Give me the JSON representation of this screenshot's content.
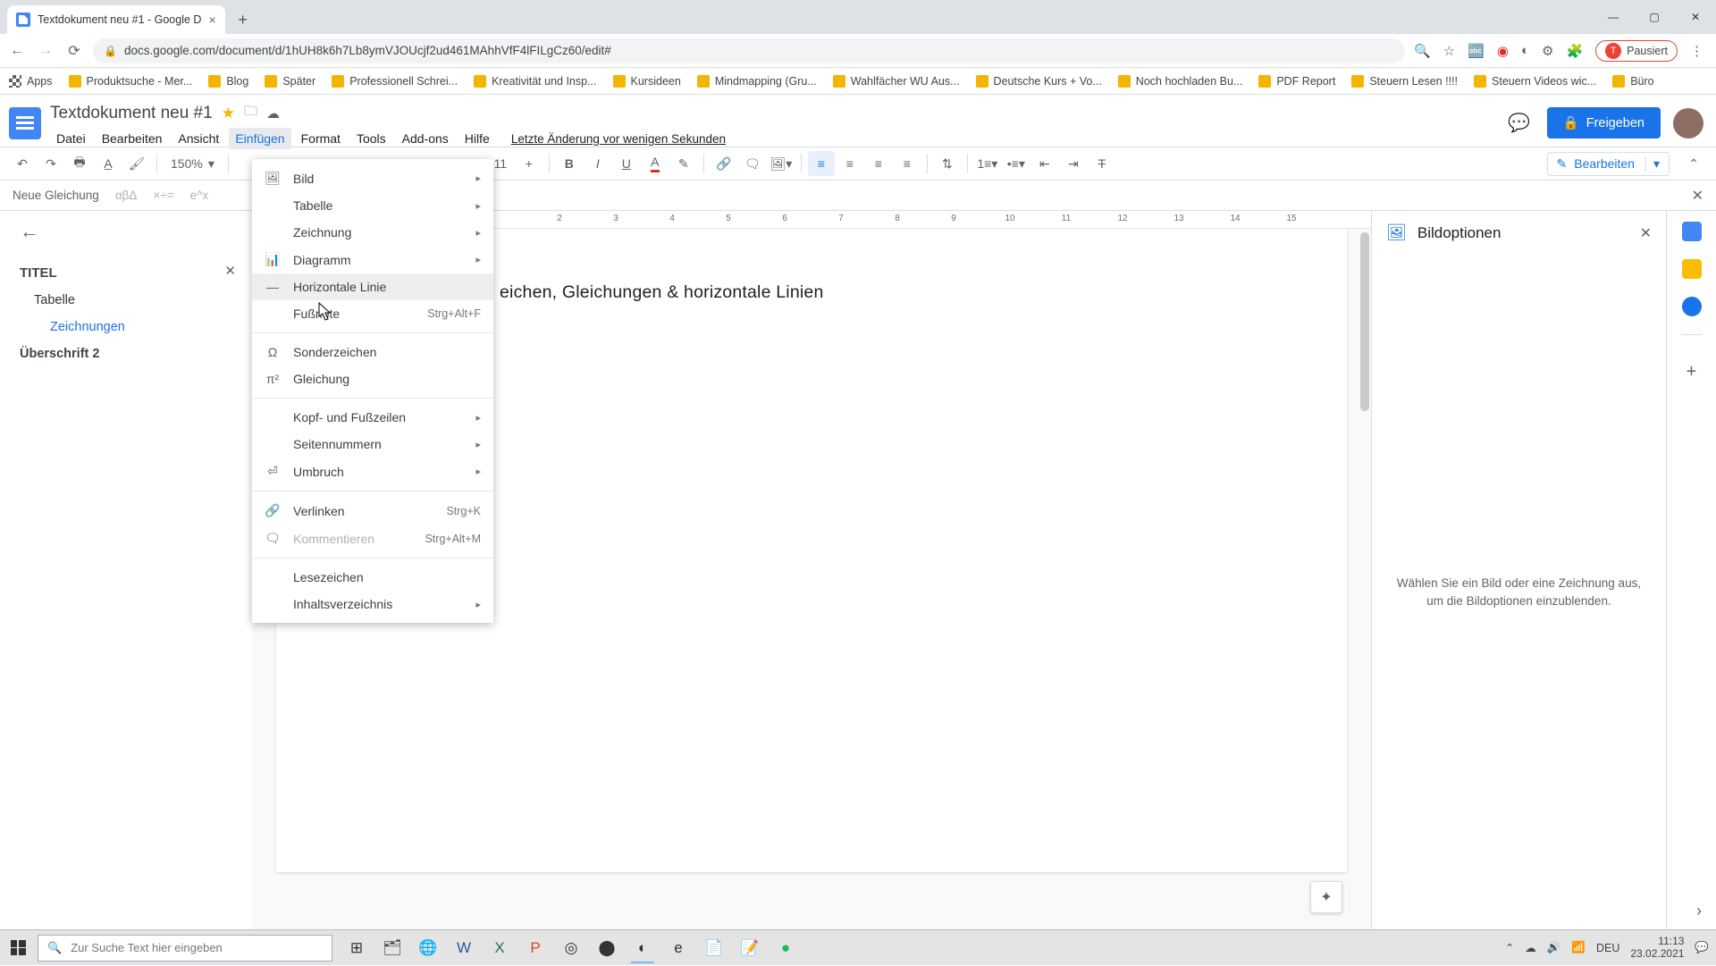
{
  "browser": {
    "tab_title": "Textdokument neu #1 - Google D",
    "url": "docs.google.com/document/d/1hUH8k6h7Lb8ymVJOUcjf2ud461MAhhVfF4lFILgCz60/edit#",
    "pausiert": "Pausiert",
    "bookmarks": [
      "Apps",
      "Produktsuche - Mer...",
      "Blog",
      "Später",
      "Professionell Schrei...",
      "Kreativität und Insp...",
      "Kursideen",
      "Mindmapping  (Gru...",
      "Wahlfächer WU Aus...",
      "Deutsche Kurs + Vo...",
      "Noch hochladen Bu...",
      "PDF Report",
      "Steuern Lesen !!!!",
      "Steuern Videos wic...",
      "Büro"
    ]
  },
  "doc": {
    "title": "Textdokument neu #1",
    "menus": [
      "Datei",
      "Bearbeiten",
      "Ansicht",
      "Einfügen",
      "Format",
      "Tools",
      "Add-ons",
      "Hilfe"
    ],
    "active_menu_index": 3,
    "last_edit": "Letzte Änderung vor wenigen Sekunden",
    "share": "Freigeben"
  },
  "toolbar": {
    "zoom": "150%",
    "font_size_partial": "11",
    "edit_mode": "Bearbeiten"
  },
  "eqbar": {
    "label": "Neue Gleichung",
    "sym1": "αβΔ",
    "sym2": "×÷=",
    "sym3": "e^x"
  },
  "outline": {
    "titel": "TITEL",
    "tabelle": "Tabelle",
    "zeichnungen": "Zeichnungen",
    "h2": "Überschrift 2"
  },
  "page": {
    "visible_heading": "eichen, Gleichungen & horizontale Linien"
  },
  "ruler": {
    "marks": [
      "",
      "2",
      "3",
      "4",
      "5",
      "6",
      "7",
      "8",
      "9",
      "10",
      "11",
      "12",
      "13",
      "14",
      "15"
    ]
  },
  "dropdown": {
    "bild": "Bild",
    "tabelle": "Tabelle",
    "zeichnung": "Zeichnung",
    "diagramm": "Diagramm",
    "horizontale": "Horizontale Linie",
    "fussnote": "Fußnote",
    "fussnote_sc": "Strg+Alt+F",
    "sonderzeichen": "Sonderzeichen",
    "gleichung": "Gleichung",
    "kopfzeilen": "Kopf- und Fußzeilen",
    "seitennummern": "Seitennummern",
    "umbruch": "Umbruch",
    "verlinken": "Verlinken",
    "verlinken_sc": "Strg+K",
    "kommentieren": "Kommentieren",
    "kommentieren_sc": "Strg+Alt+M",
    "lesezeichen": "Lesezeichen",
    "inhalt": "Inhaltsverzeichnis"
  },
  "side_panel": {
    "title": "Bildoptionen",
    "empty": "Wählen Sie ein Bild oder eine Zeichnung aus, um die Bildoptionen einzublenden."
  },
  "taskbar": {
    "search_placeholder": "Zur Suche Text hier eingeben",
    "lang": "DEU",
    "time": "11:13",
    "date": "23.02.2021"
  }
}
